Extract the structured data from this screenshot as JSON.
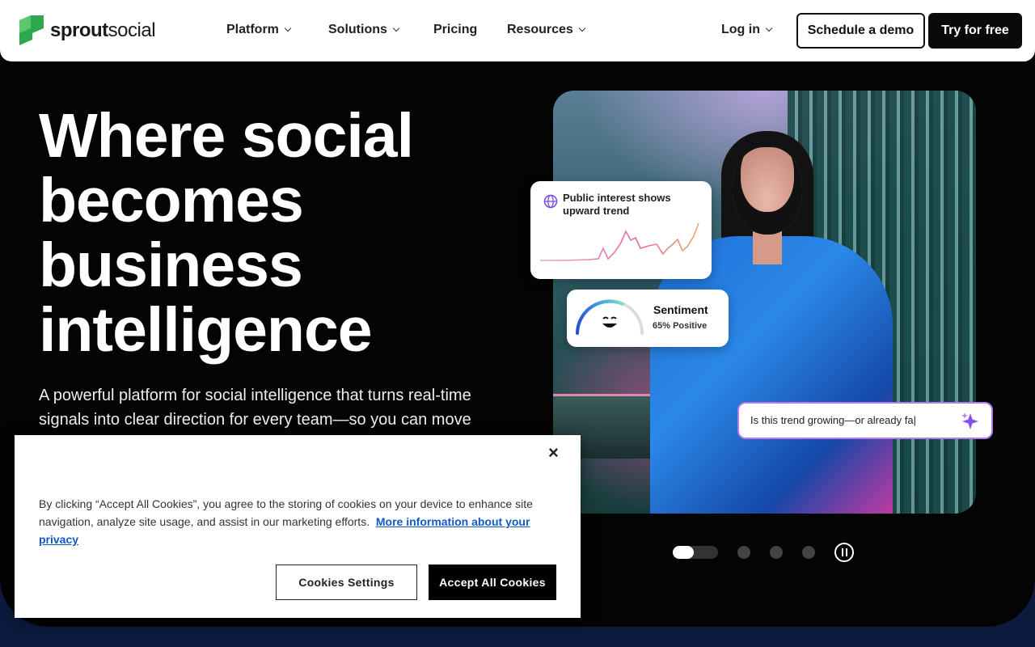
{
  "nav": {
    "logo_bold": "sprout",
    "logo_light": "social",
    "items": [
      {
        "label": "Platform"
      },
      {
        "label": "Solutions"
      },
      {
        "label": "Pricing"
      },
      {
        "label": "Resources"
      }
    ],
    "login": "Log in",
    "demo_button": "Schedule a demo",
    "try_button": "Try for free"
  },
  "hero": {
    "headline": "Where social becomes business intelligence",
    "subtext": "A powerful platform for social intelligence that turns real-time signals into clear direction for every team—so you can move"
  },
  "cards": {
    "trend_title": "Public interest shows upward trend",
    "sentiment_title": "Sentiment",
    "sentiment_value": "65% Positive",
    "prompt_text": "Is this trend growing—or already fa|"
  },
  "cookie": {
    "close_glyph": "×",
    "text": "By clicking “Accept All Cookies”, you agree to the storing of cookies on your device to enhance site navigation, analyze site usage, and assist in our marketing efforts.",
    "link": "More information about your privacy",
    "settings_button": "Cookies Settings",
    "accept_button": "Accept All Cookies"
  },
  "colors": {
    "brand_green": "#2ea84f",
    "accent_purple": "#b07cf0",
    "link_blue": "#1259c3"
  }
}
